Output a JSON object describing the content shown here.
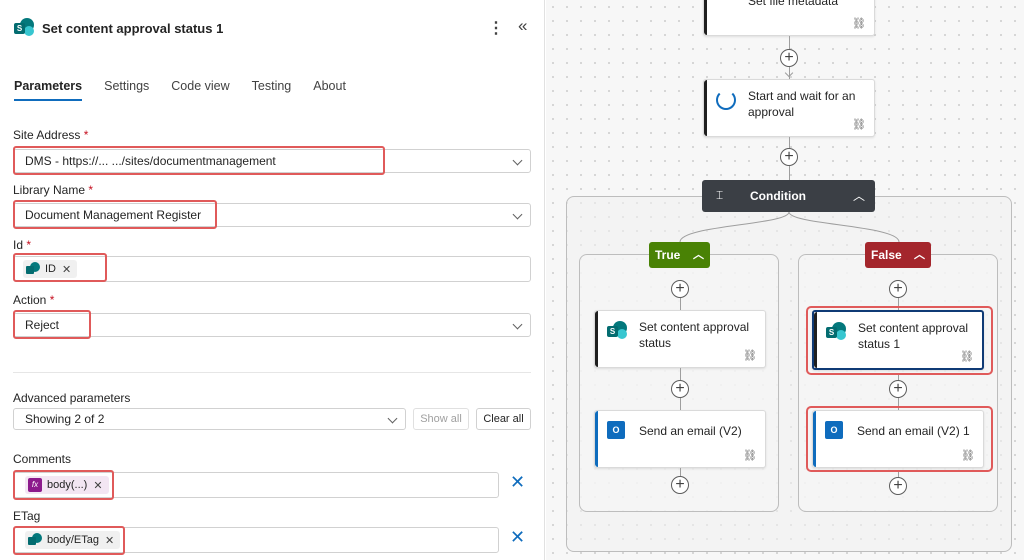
{
  "panel": {
    "title": "Set content approval status 1",
    "more_icon": "more-vertical-icon",
    "collapse_icon": "double-chevron-left-icon",
    "tabs": [
      "Parameters",
      "Settings",
      "Code view",
      "Testing",
      "About"
    ],
    "active_tab": "Parameters",
    "fields": {
      "site_address": {
        "label": "Site Address",
        "required": "*",
        "value": "DMS - https://...  .../sites/documentmanagement"
      },
      "library_name": {
        "label": "Library Name",
        "required": "*",
        "value": "Document Management Register"
      },
      "id": {
        "label": "Id",
        "required": "*",
        "token": "ID"
      },
      "action": {
        "label": "Action",
        "required": "*",
        "value": "Reject"
      }
    },
    "advanced": {
      "label": "Advanced parameters",
      "showing": "Showing 2 of 2",
      "show_all": "Show all",
      "clear_all": "Clear all"
    },
    "comments": {
      "label": "Comments",
      "token": "body(...)"
    },
    "etag": {
      "label": "ETag",
      "token": "body/ETag"
    }
  },
  "canvas": {
    "top_card_title": "Set file metadata",
    "approval_card_title_1": "Start and wait for an",
    "approval_card_title_2": "approval",
    "condition_label": "Condition",
    "true_label": "True",
    "false_label": "False",
    "true_branch": {
      "card1_line1": "Set content approval",
      "card1_line2": "status",
      "card2": "Send an email (V2)"
    },
    "false_branch": {
      "card1_line1": "Set content approval",
      "card1_line2": "status 1",
      "card2": "Send an email (V2) 1"
    },
    "colors": {
      "true": "#498205",
      "false": "#a4262c",
      "condition": "#3b3f45",
      "accent": "#0f6cbd",
      "highlight": "#e05a5a"
    }
  }
}
